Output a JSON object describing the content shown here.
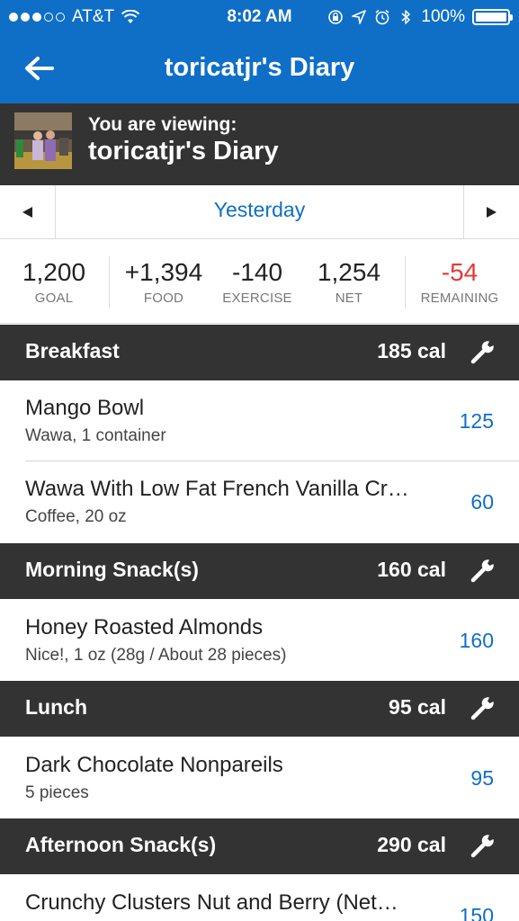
{
  "status_bar": {
    "carrier": "AT&T",
    "time": "8:02 AM",
    "battery": "100%",
    "battery_level": 1.0
  },
  "nav": {
    "title": "toricatjr's Diary",
    "back_icon": "back-arrow-icon"
  },
  "viewing": {
    "label": "You are viewing:",
    "name": "toricatjr's Diary"
  },
  "date": {
    "label": "Yesterday"
  },
  "summary": {
    "goal": {
      "value": "1,200",
      "label": "GOAL"
    },
    "food": {
      "value": "+1,394",
      "label": "FOOD"
    },
    "exercise": {
      "value": "-140",
      "label": "EXERCISE"
    },
    "net": {
      "value": "1,254",
      "label": "NET"
    },
    "remaining": {
      "value": "-54",
      "label": "REMAINING"
    }
  },
  "colors": {
    "brand_blue": "#0f6fc6",
    "header_dark": "#333333",
    "negative_red": "#e53935"
  },
  "meals": [
    {
      "name": "Breakfast",
      "calories": "185 cal",
      "items": [
        {
          "name": "Mango Bowl",
          "desc": "Wawa, 1 container",
          "cal": "125"
        },
        {
          "name": "Wawa With Low Fat French Vanilla Cr…",
          "desc": "Coffee, 20 oz",
          "cal": "60"
        }
      ]
    },
    {
      "name": "Morning Snack(s)",
      "calories": "160 cal",
      "items": [
        {
          "name": "Honey Roasted Almonds",
          "desc": "Nice!, 1 oz (28g / About 28 pieces)",
          "cal": "160"
        }
      ]
    },
    {
      "name": "Lunch",
      "calories": "95 cal",
      "items": [
        {
          "name": "Dark Chocolate Nonpareils",
          "desc": "5 pieces",
          "cal": "95"
        }
      ]
    },
    {
      "name": "Afternoon Snack(s)",
      "calories": "290 cal",
      "items": [
        {
          "name": "Crunchy Clusters Nut and Berry (Net…",
          "desc": "",
          "cal": "150"
        }
      ]
    }
  ]
}
